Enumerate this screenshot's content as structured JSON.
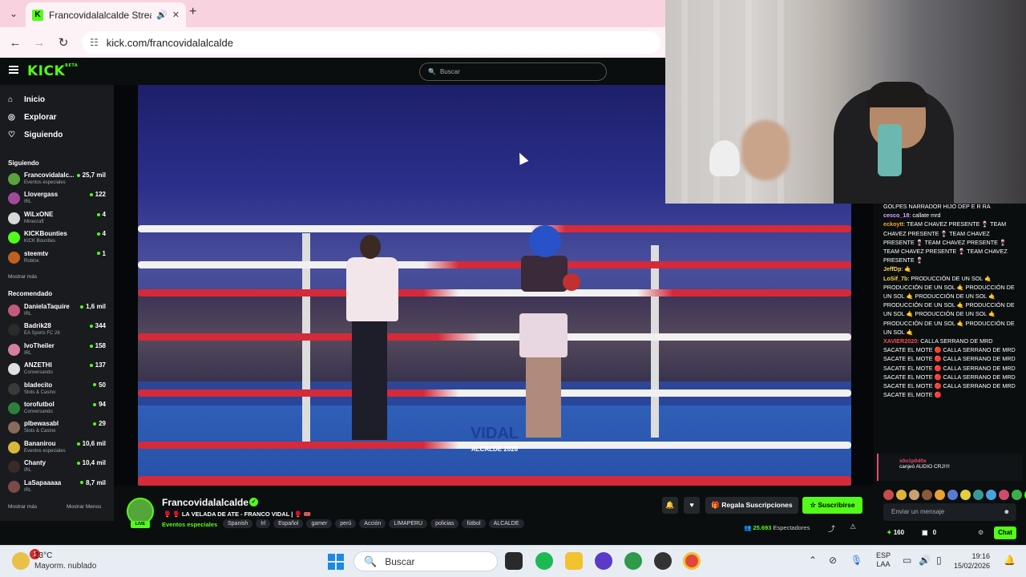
{
  "browser": {
    "tab_title": "Francovidalalcalde Stream",
    "tab_fav": "K",
    "url": "kick.com/francovidalalcalde"
  },
  "kick": {
    "logo": "KICK",
    "logo_beta": "BETA",
    "search_placeholder": "Buscar"
  },
  "sidebar": {
    "nav": [
      {
        "label": "Inicio",
        "icon": "home-icon"
      },
      {
        "label": "Explorar",
        "icon": "compass-icon"
      },
      {
        "label": "Siguiendo",
        "icon": "heart-icon"
      }
    ],
    "following_title": "Siguiendo",
    "following": [
      {
        "name": "Francovidalalc...",
        "sub": "Eventos especiales",
        "viewers": "25,7 mil",
        "color": "#5aa33e"
      },
      {
        "name": "Llovergass",
        "sub": "IRL",
        "viewers": "122",
        "color": "#a04a9a"
      },
      {
        "name": "WiLxONE",
        "sub": "Minecraft",
        "viewers": "4",
        "color": "#d8d8d8"
      },
      {
        "name": "KICKBounties",
        "sub": "KICK Bounties",
        "viewers": "4",
        "color": "#53fc18"
      },
      {
        "name": "steemtv",
        "sub": "Roblox",
        "viewers": "1",
        "color": "#c0601e"
      }
    ],
    "following_more": "Mostrar más",
    "recommended_title": "Recomendado",
    "recommended": [
      {
        "name": "DanielaTaquire",
        "sub": "IRL",
        "viewers": "1,6 mil",
        "color": "#c25a7a"
      },
      {
        "name": "Badrik28",
        "sub": "EA Sports FC 26",
        "viewers": "344",
        "color": "#2b2b2b"
      },
      {
        "name": "IvoTheiler",
        "sub": "IRL",
        "viewers": "158",
        "color": "#d67e9e"
      },
      {
        "name": "ANZETHI",
        "sub": "Conversando",
        "viewers": "137",
        "color": "#e0e0e0"
      },
      {
        "name": "bladecito",
        "sub": "Slots & Casino",
        "viewers": "50",
        "color": "#3a3a3a"
      },
      {
        "name": "torofutbol",
        "sub": "Conversando",
        "viewers": "94",
        "color": "#2d7f3a"
      },
      {
        "name": "plbewasabl",
        "sub": "Slots & Casino",
        "viewers": "29",
        "color": "#8a6a5a"
      },
      {
        "name": "Bananirou",
        "sub": "Eventos especiales",
        "viewers": "10,6 mil",
        "color": "#d8b83a"
      },
      {
        "name": "Chanty",
        "sub": "IRL",
        "viewers": "10,4 mil",
        "color": "#3a2a2a"
      },
      {
        "name": "LaSapaaaaa",
        "sub": "IRL",
        "viewers": "8,7 mil",
        "color": "#7a4a4a"
      }
    ],
    "rec_more": "Mostrar más",
    "rec_less": "Mostrar Menos"
  },
  "video": {
    "watermark_main": "VIDAL",
    "watermark_sub": "ALCALDE 2026"
  },
  "chat": {
    "messages": [
      {
        "user": "",
        "text": "GOLPES NARRADOR HIJO DEP E R RA",
        "color": "#fff"
      },
      {
        "user": "cesco_18",
        "text": "callate mrd",
        "color": "#dca0ff"
      },
      {
        "user": "eckoytt",
        "text": "TEAM CHAVEZ PRESENTE 🍷 TEAM CHAVEZ PRESENTE 🍷 TEAM CHAVEZ PRESENTE 🍷 TEAM CHAVEZ PRESENTE 🍷 TEAM CHAVEZ PRESENTE 🍷 TEAM CHAVEZ PRESENTE 🍷",
        "color": "#f5a623"
      },
      {
        "user": "JeffDp",
        "text": "🤙",
        "color": "#ffd34d"
      },
      {
        "user": "LoSif_7b",
        "text": "PRODUCCIÓN DE UN SOL 🤙 PRODUCCIÓN DE UN SOL 🤙 PRODUCCIÓN DE UN SOL 🤙 PRODUCCIÓN DE UN SOL 🤙 PRODUCCIÓN DE UN SOL 🤙 PRODUCCIÓN DE UN SOL 🤙 PRODUCCIÓN DE UN SOL 🤙 PRODUCCIÓN DE UN SOL 🤙 PRODUCCIÓN DE UN SOL 🤙",
        "color": "#ffd34d"
      },
      {
        "user": "XAVIER2020",
        "text": "CALLA SERRANO DE MRD SACATE EL MOTE 🔴 CALLA SERRANO DE MRD SACATE EL MOTE 🔴 CALLA SERRANO DE MRD SACATE EL MOTE 🔴 CALLA SERRANO DE MRD SACATE EL MOTE 🔴 CALLA SERRANO DE MRD SACATE EL MOTE 🔴 CALLA SERRANO DE MRD SACATE EL MOTE 🔴",
        "color": "#ff4b4b"
      }
    ],
    "pinned_user": "x0o1p0d0x",
    "pinned_text": "canjeó AUDIO CRJ!!!!",
    "input_placeholder": "Enviar un mensaje",
    "points": "160",
    "points2": "0",
    "chat_button": "Chat"
  },
  "stream": {
    "name": "Francovidalalcalde",
    "title": "🥊 🥊  LA VELADA DE ATE - FRANCO VIDAL | 🥊 🎟️",
    "category": "Eventos especiales",
    "tags": [
      "Spanish",
      "Irl",
      "Español",
      "gamer",
      "perú",
      "Acción",
      "LIMAPERU",
      "policias",
      "fútbol",
      "ALCALDE"
    ],
    "live_label": "LIVE",
    "gift_label": "Regala Suscripciones",
    "subscribe_label": "Suscribirse",
    "viewers_count": "25.693",
    "viewers_label": "Espectadores"
  },
  "taskbar": {
    "temp": "23°C",
    "weather": "Mayorm. nublado",
    "weather_badge": "1",
    "search_label": "Buscar",
    "lang1": "ESP",
    "lang2": "LAA",
    "time": "19:16",
    "date": "15/02/2026"
  }
}
